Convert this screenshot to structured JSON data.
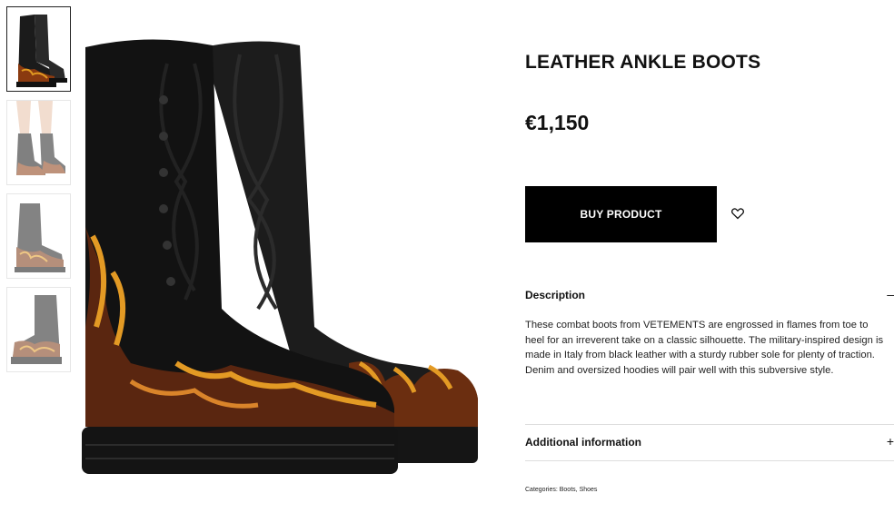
{
  "product": {
    "title": "LEATHER ANKLE BOOTS",
    "price": "€1,150",
    "buy_label": "BUY PRODUCT"
  },
  "gallery": {
    "thumbnails": [
      {
        "name": "thumbnail-1",
        "active": true
      },
      {
        "name": "thumbnail-2",
        "active": false
      },
      {
        "name": "thumbnail-3",
        "active": false
      },
      {
        "name": "thumbnail-4",
        "active": false
      }
    ]
  },
  "sections": {
    "description": {
      "label": "Description",
      "toggle": "–",
      "text": "These combat boots from VETEMENTS are engrossed in flames from toe to heel for an irreverent take on a classic silhouette. The military-inspired design is made in Italy from black leather with a sturdy rubber sole for plenty of traction. Denim and oversized hoodies will pair well with this subversive style."
    },
    "additional": {
      "label": "Additional information",
      "toggle": "+"
    }
  },
  "categories": {
    "prefix": "Categories:",
    "items": [
      "Boots",
      "Shoes"
    ],
    "separator": ","
  },
  "icons": {
    "wishlist": "heart-icon"
  },
  "colors": {
    "button_bg": "#000000",
    "button_text": "#ffffff",
    "divider": "#dddddd"
  }
}
